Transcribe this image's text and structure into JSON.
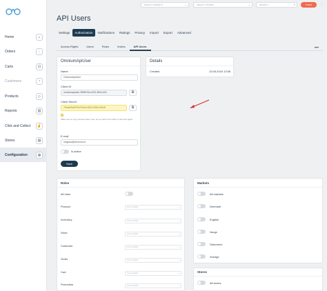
{
  "sidebar": {
    "items": [
      {
        "label": "Home",
        "icon": "home-icon",
        "glyph": "⌂"
      },
      {
        "label": "Orders",
        "icon": "list-icon",
        "glyph": "⋮"
      },
      {
        "label": "Carts",
        "icon": "cart-icon",
        "glyph": "⊡"
      },
      {
        "label": "Customers",
        "icon": "user-icon",
        "glyph": "◔"
      },
      {
        "label": "Products",
        "icon": "tag-icon",
        "glyph": "◇"
      },
      {
        "label": "Reports",
        "icon": "chart-icon",
        "glyph": "▥"
      },
      {
        "label": "Click and Collect",
        "icon": "hand-icon",
        "glyph": "☝"
      },
      {
        "label": "Stores",
        "icon": "store-icon",
        "glyph": "▤"
      },
      {
        "label": "Configuration",
        "icon": "gear-icon",
        "glyph": "◎"
      }
    ]
  },
  "topbar": {
    "select_markets": "SELECT MARKETS",
    "select_stores": "SELECT STORES",
    "search_placeholder": "SEARCH",
    "action_button": "8 NEW"
  },
  "page": {
    "title": "API Users",
    "tabs": [
      "Settings",
      "Authorization",
      "Notifications",
      "Ratings",
      "Privacy",
      "Import",
      "Export",
      "Advanced"
    ],
    "subtabs": [
      "Access Rights",
      "Users",
      "Roles",
      "Invites",
      "API Users"
    ]
  },
  "user_card": {
    "title": "OmniumApiUser",
    "name_label": "Name",
    "name_value": "OmniumApiUser",
    "client_id_label": "Client ID",
    "client_id_value": "omniumapiuser-389fb7bb-a700-481b-b2b",
    "client_secret_label": "Client Secret",
    "client_secret_value": "7f6aab9a8f294d7f4bbc35411265d-83e8f",
    "secret_note": "Make sure to copy access token now, as you will not be able to view this again.",
    "email_label": "E-mail",
    "email_value": "magnus@omnium.no",
    "active_label": "Is active",
    "save_label": "Save"
  },
  "details_card": {
    "title": "Details",
    "created_label": "Created",
    "created_value": "13.05.2024 13:06"
  },
  "roles_card": {
    "title": "Roles",
    "all_roles_label": "All roles",
    "select_placeholder": "NO ACCESS",
    "rows": [
      "Product",
      "Inventory",
      "Store",
      "Customer",
      "Order",
      "Cart",
      "Promotion"
    ]
  },
  "markets_card": {
    "title": "Markets",
    "rows": [
      "All markets",
      "Denmark",
      "English",
      "Norge",
      "Österreich",
      "Sverige"
    ]
  },
  "stores_card": {
    "title": "Stores",
    "rows": [
      "All stores"
    ]
  },
  "colors": {
    "accent": "#1d3a4f",
    "action": "#f06a4e",
    "highlight": "#fdf6c2",
    "arrow": "#d9302c"
  }
}
